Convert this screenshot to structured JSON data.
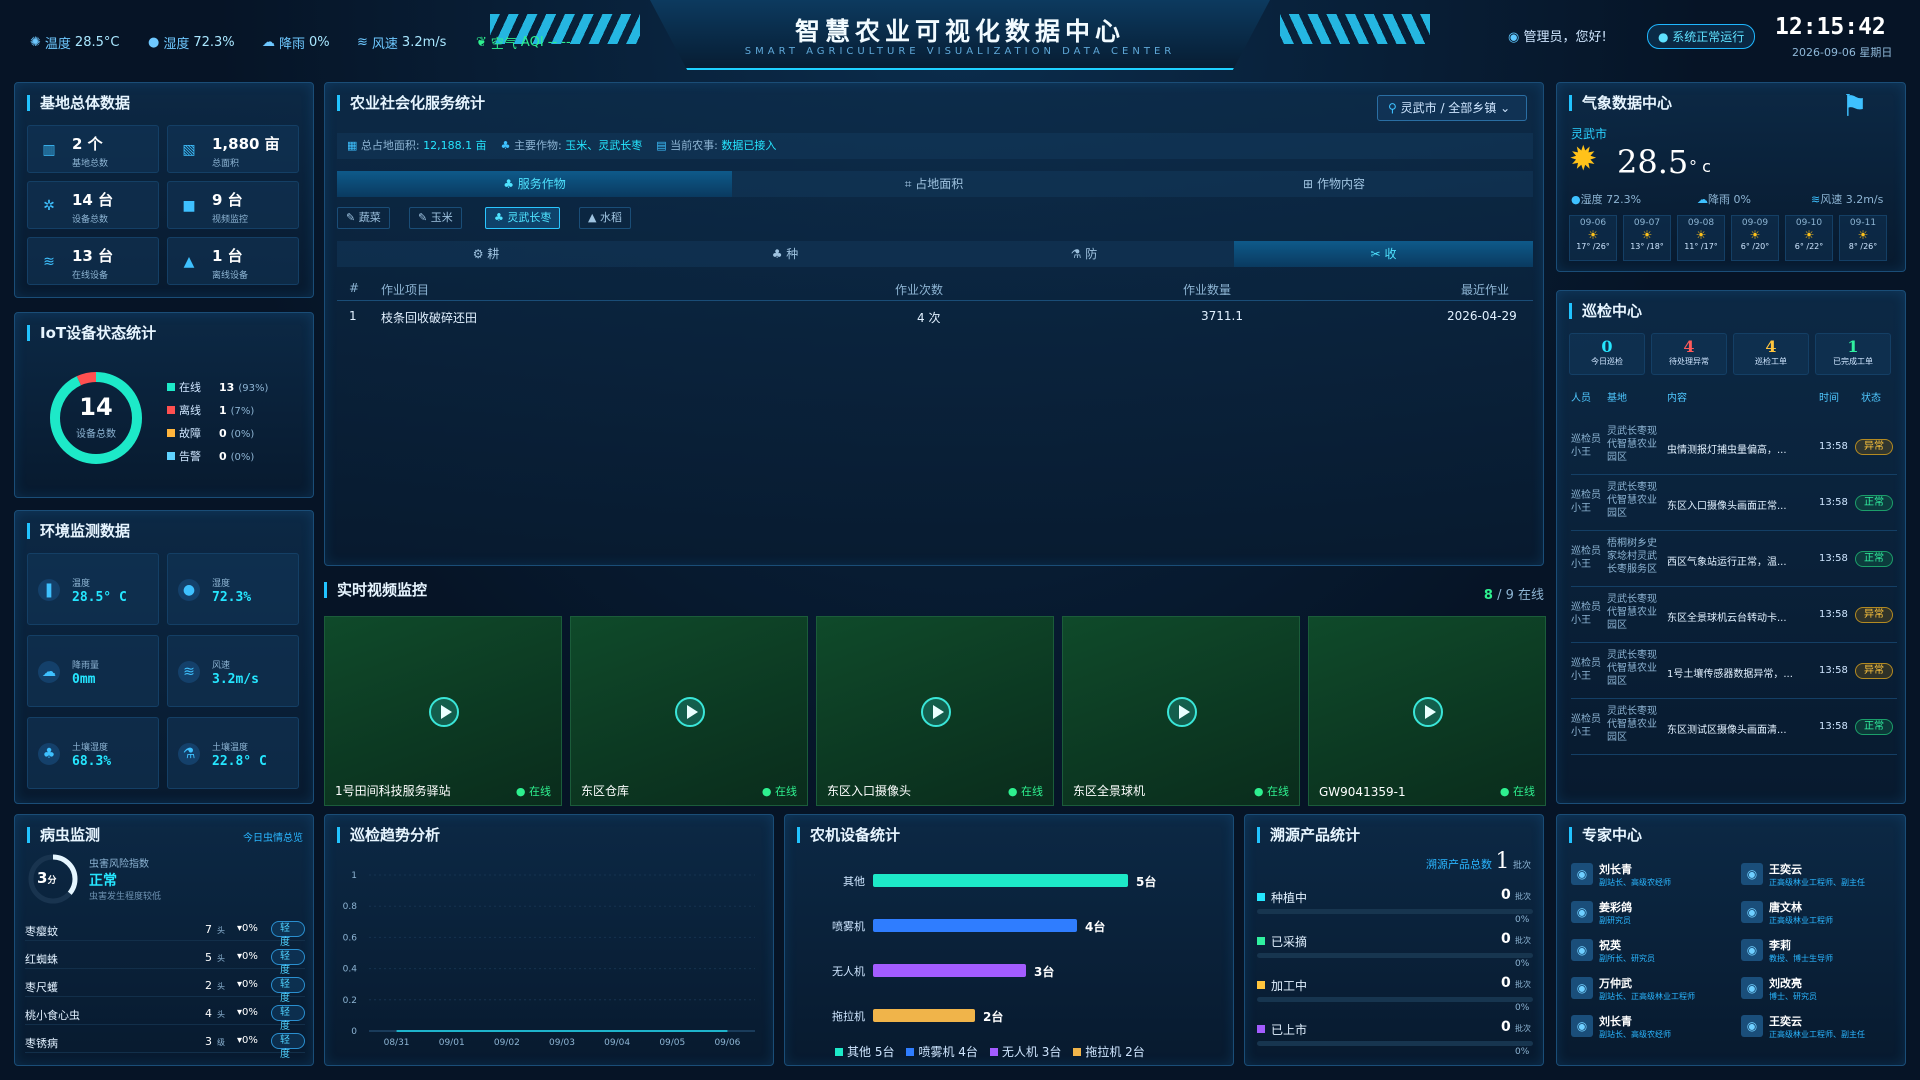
{
  "header": {
    "title": "智慧农业可视化数据中心",
    "subtitle": "SMART AGRICULTURE VISUALIZATION DATA CENTER",
    "weather": [
      {
        "label": "温度",
        "value": "28.5°C",
        "icon": "thermometer-icon"
      },
      {
        "label": "湿度",
        "value": "72.3%",
        "icon": "droplet-icon"
      },
      {
        "label": "降雨",
        "value": "0%",
        "icon": "rain-icon"
      },
      {
        "label": "风速",
        "value": "3.2m/s",
        "icon": "wind-icon"
      },
      {
        "label": "空气",
        "value": "AQI -- --",
        "icon": "leaf-icon"
      }
    ],
    "user_greeting": "管理员，您好!",
    "status_badge": "● 系统正常运行",
    "time": "12:15:42",
    "date": "2026-09-06 星期日"
  },
  "base_overview": {
    "title": "基地总体数据",
    "cards": [
      {
        "value": "2 个",
        "label": "基地总数",
        "icon": "building-icon"
      },
      {
        "value": "1,880 亩",
        "label": "总面积",
        "icon": "map-icon"
      },
      {
        "value": "14 台",
        "label": "设备总数",
        "icon": "chip-icon"
      },
      {
        "value": "9 台",
        "label": "视频监控",
        "icon": "camera-icon"
      },
      {
        "value": "13 台",
        "label": "在线设备",
        "icon": "wifi-icon"
      },
      {
        "value": "1 台",
        "label": "离线设备",
        "icon": "warning-icon"
      }
    ]
  },
  "iot": {
    "title": "IoT设备状态统计",
    "total": "14",
    "total_label": "设备总数",
    "online_fraction": 0.93,
    "legend": [
      {
        "name": "在线",
        "count": "13",
        "pct": "(93%)",
        "color": "#1de9c8"
      },
      {
        "name": "离线",
        "count": "1",
        "pct": "(7%)",
        "color": "#ff5050"
      },
      {
        "name": "故障",
        "count": "0",
        "pct": "(0%)",
        "color": "#ffb53d"
      },
      {
        "name": "告警",
        "count": "0",
        "pct": "(0%)",
        "color": "#5fd2ff"
      }
    ]
  },
  "env": {
    "title": "环境监测数据",
    "cards": [
      {
        "label": "温度",
        "value": "28.5° C",
        "icon": "thermometer-icon"
      },
      {
        "label": "湿度",
        "value": "72.3%",
        "icon": "droplet-icon"
      },
      {
        "label": "降雨量",
        "value": "0mm",
        "icon": "rain-icon"
      },
      {
        "label": "风速",
        "value": "3.2m/s",
        "icon": "wind-icon"
      },
      {
        "label": "土壤湿度",
        "value": "68.3%",
        "icon": "sprout-icon"
      },
      {
        "label": "土壤温度",
        "value": "22.8° C",
        "icon": "flask-icon"
      }
    ]
  },
  "service": {
    "title": "农业社会化服务统计",
    "region": "灵武市 / 全部乡镇",
    "info": [
      {
        "label": "总占地面积:",
        "value": "12,188.1 亩"
      },
      {
        "label": "主要作物:",
        "value": "玉米、灵武长枣"
      },
      {
        "label": "当前农事:",
        "value": "数据已接入"
      }
    ],
    "tabs": [
      "服务作物",
      "占地面积",
      "作物内容"
    ],
    "crops": [
      "蔬菜",
      "玉米",
      "灵武长枣",
      "水稻"
    ],
    "stages": [
      "耕",
      "种",
      "防",
      "收"
    ],
    "table_headers": [
      "#",
      "作业项目",
      "作业次数",
      "作业数量",
      "最近作业"
    ],
    "rows": [
      [
        "1",
        "枝条回收破碎还田",
        "4 次",
        "3711.1",
        "2026-04-29"
      ]
    ]
  },
  "video": {
    "title": "实时视频监控",
    "online": "8",
    "total": "/ 9 在线",
    "cams": [
      {
        "name": "1号田间科技服务驿站",
        "status": "● 在线"
      },
      {
        "name": "东区仓库",
        "status": "● 在线"
      },
      {
        "name": "东区入口摄像头",
        "status": "● 在线"
      },
      {
        "name": "东区全景球机",
        "status": "● 在线"
      },
      {
        "name": "GW9041359-1",
        "status": "● 在线"
      }
    ]
  },
  "weather_center": {
    "title": "气象数据中心",
    "city": "灵武市",
    "temp": "28.5",
    "unit": "° c",
    "humidity": "湿度 72.3%",
    "rain": "降雨 0%",
    "wind": "风速 3.2m/s",
    "forecast": [
      {
        "date": "09-06",
        "range": "17° /26°"
      },
      {
        "date": "09-07",
        "range": "13° /18°"
      },
      {
        "date": "09-08",
        "range": "11° /17°"
      },
      {
        "date": "09-09",
        "range": "6° /20°"
      },
      {
        "date": "09-10",
        "range": "6° /22°"
      },
      {
        "date": "09-11",
        "range": "8° /26°"
      }
    ]
  },
  "patrol": {
    "title": "巡检中心",
    "stats": [
      {
        "value": "0",
        "label": "今日巡检",
        "color": "#25e6ff"
      },
      {
        "value": "4",
        "label": "待处理异常",
        "color": "#ff5a5a"
      },
      {
        "value": "4",
        "label": "巡检工单",
        "color": "#ffc53d"
      },
      {
        "value": "1",
        "label": "已完成工单",
        "color": "#30f0a0"
      }
    ],
    "headers": [
      "人员",
      "基地",
      "内容",
      "时间",
      "状态"
    ],
    "rows": [
      {
        "person": "巡检员小王",
        "base": "灵武长枣现代智慧农业园区",
        "content": "虫情测报灯捕虫量偏高，...",
        "time": "13:58",
        "status": "异常",
        "kind": "warn"
      },
      {
        "person": "巡检员小王",
        "base": "灵武长枣现代智慧农业园区",
        "content": "东区入口摄像头画面正常...",
        "time": "13:58",
        "status": "正常",
        "kind": "ok"
      },
      {
        "person": "巡检员小王",
        "base": "梧桐树乡史家埝村灵武长枣服务区",
        "content": "西区气象站运行正常，温...",
        "time": "13:58",
        "status": "正常",
        "kind": "ok"
      },
      {
        "person": "巡检员小王",
        "base": "灵武长枣现代智慧农业园区",
        "content": "东区全景球机云台转动卡...",
        "time": "13:58",
        "status": "异常",
        "kind": "warn"
      },
      {
        "person": "巡检员小王",
        "base": "灵武长枣现代智慧农业园区",
        "content": "1号土壤传感器数据异常，...",
        "time": "13:58",
        "status": "异常",
        "kind": "warn"
      },
      {
        "person": "巡检员小王",
        "base": "灵武长枣现代智慧农业园区",
        "content": "东区测试区摄像头画面清...",
        "time": "13:58",
        "status": "正常",
        "kind": "ok"
      }
    ]
  },
  "pest": {
    "title": "病虫监测",
    "link": "今日虫情总览",
    "gauge_value": "3",
    "gauge_unit": "分",
    "risk_label": "虫害风险指数",
    "risk_state": "正常",
    "risk_note": "虫害发生程度较低",
    "items": [
      {
        "name": "枣瘿蚊",
        "count": "7",
        "unit": "头",
        "trend": "▾0%",
        "level": "轻度"
      },
      {
        "name": "红蜘蛛",
        "count": "5",
        "unit": "头",
        "trend": "▾0%",
        "level": "轻度"
      },
      {
        "name": "枣尺蠖",
        "count": "2",
        "unit": "头",
        "trend": "▾0%",
        "level": "轻度"
      },
      {
        "name": "桃小食心虫",
        "count": "4",
        "unit": "头",
        "trend": "▾0%",
        "level": "轻度"
      },
      {
        "name": "枣锈病",
        "count": "3",
        "unit": "级",
        "trend": "▾0%",
        "level": "轻度"
      }
    ]
  },
  "trend": {
    "title": "巡检趋势分析",
    "chart_data": {
      "type": "line",
      "x": [
        "08/31",
        "09/01",
        "09/02",
        "09/03",
        "09/04",
        "09/05",
        "09/06"
      ],
      "y_ticks": [
        "0",
        "0.2",
        "0.4",
        "0.6",
        "0.8",
        "1"
      ],
      "ylim": [
        0,
        1
      ],
      "series": [
        {
          "values": [
            0,
            0,
            0,
            0,
            0,
            0,
            0
          ]
        }
      ]
    }
  },
  "machines": {
    "title": "农机设备统计",
    "chart_data": {
      "type": "bar",
      "categories": [
        "其他",
        "喷雾机",
        "无人机",
        "拖拉机"
      ],
      "values": [
        5,
        4,
        3,
        2
      ],
      "value_labels": [
        "5台",
        "4台",
        "3台",
        "2台"
      ],
      "colors": [
        "#1de9c8",
        "#2f7dff",
        "#a35cff",
        "#f0b44a"
      ],
      "legend": [
        "其他 5台",
        "喷雾机 4台",
        "无人机 3台",
        "拖拉机 2台"
      ]
    }
  },
  "trace": {
    "title": "溯源产品统计",
    "total_label": "溯源产品总数",
    "total": "1",
    "unit": "批次",
    "items": [
      {
        "name": "种植中",
        "value": "0",
        "unit": "批次",
        "pct": "0%",
        "color": "#25e6ff"
      },
      {
        "name": "已采摘",
        "value": "0",
        "unit": "批次",
        "pct": "0%",
        "color": "#30f0a0"
      },
      {
        "name": "加工中",
        "value": "0",
        "unit": "批次",
        "pct": "0%",
        "color": "#ffc53d"
      },
      {
        "name": "已上市",
        "value": "0",
        "unit": "批次",
        "pct": "0%",
        "color": "#a35cff"
      }
    ]
  },
  "experts": {
    "title": "专家中心",
    "list": [
      {
        "name": "刘长青",
        "desc": "副站长、高级农经师"
      },
      {
        "name": "王奕云",
        "desc": "正高级林业工程师、副主任"
      },
      {
        "name": "姜彩鸽",
        "desc": "副研究员"
      },
      {
        "name": "唐文林",
        "desc": "正高级林业工程师"
      },
      {
        "name": "祝英",
        "desc": "副所长、研究员"
      },
      {
        "name": "李莉",
        "desc": "教授、博士生导师"
      },
      {
        "name": "万仲武",
        "desc": "副站长、正高级林业工程师"
      },
      {
        "name": "刘改亮",
        "desc": "博士、研究员"
      },
      {
        "name": "刘长青",
        "desc": "副站长、高级农经师"
      },
      {
        "name": "王奕云",
        "desc": "正高级林业工程师、副主任"
      }
    ]
  }
}
